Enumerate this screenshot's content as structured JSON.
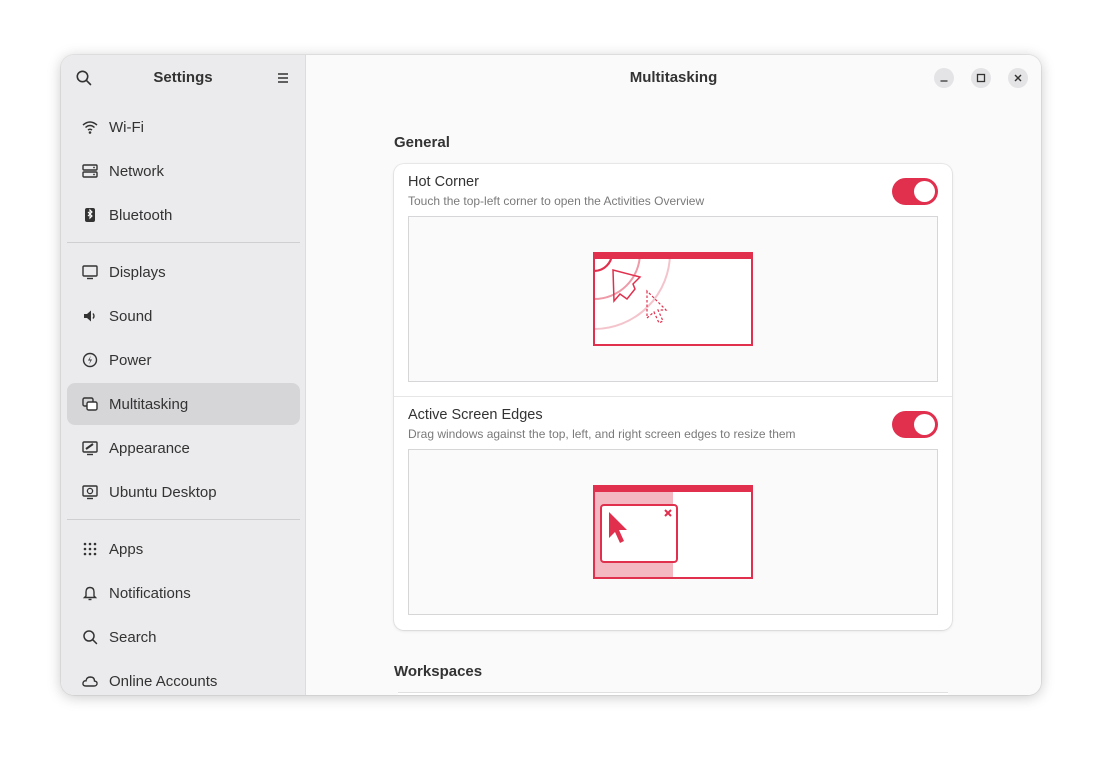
{
  "sidebar": {
    "title": "Settings",
    "groups": [
      [
        {
          "label": "Wi-Fi",
          "icon": "wifi-icon"
        },
        {
          "label": "Network",
          "icon": "network-icon"
        },
        {
          "label": "Bluetooth",
          "icon": "bluetooth-icon"
        }
      ],
      [
        {
          "label": "Displays",
          "icon": "display-icon"
        },
        {
          "label": "Sound",
          "icon": "speaker-icon"
        },
        {
          "label": "Power",
          "icon": "power-icon"
        },
        {
          "label": "Multitasking",
          "icon": "multitasking-icon",
          "active": true
        },
        {
          "label": "Appearance",
          "icon": "appearance-icon"
        },
        {
          "label": "Ubuntu Desktop",
          "icon": "ubuntu-desktop-icon"
        }
      ],
      [
        {
          "label": "Apps",
          "icon": "apps-grid-icon"
        },
        {
          "label": "Notifications",
          "icon": "bell-icon"
        },
        {
          "label": "Search",
          "icon": "search-icon"
        },
        {
          "label": "Online Accounts",
          "icon": "cloud-icon"
        }
      ]
    ]
  },
  "main": {
    "title": "Multitasking",
    "general": {
      "heading": "General",
      "hot_corner": {
        "title": "Hot Corner",
        "subtitle": "Touch the top-left corner to open the Activities Overview",
        "enabled": true
      },
      "active_edges": {
        "title": "Active Screen Edges",
        "subtitle": "Drag windows against the top, left, and right screen edges to resize them",
        "enabled": true
      }
    },
    "workspaces": {
      "heading": "Workspaces"
    }
  },
  "colors": {
    "accent": "#e0304e",
    "sidebar_bg": "#ebebed",
    "active_item": "#d6d6d8"
  }
}
